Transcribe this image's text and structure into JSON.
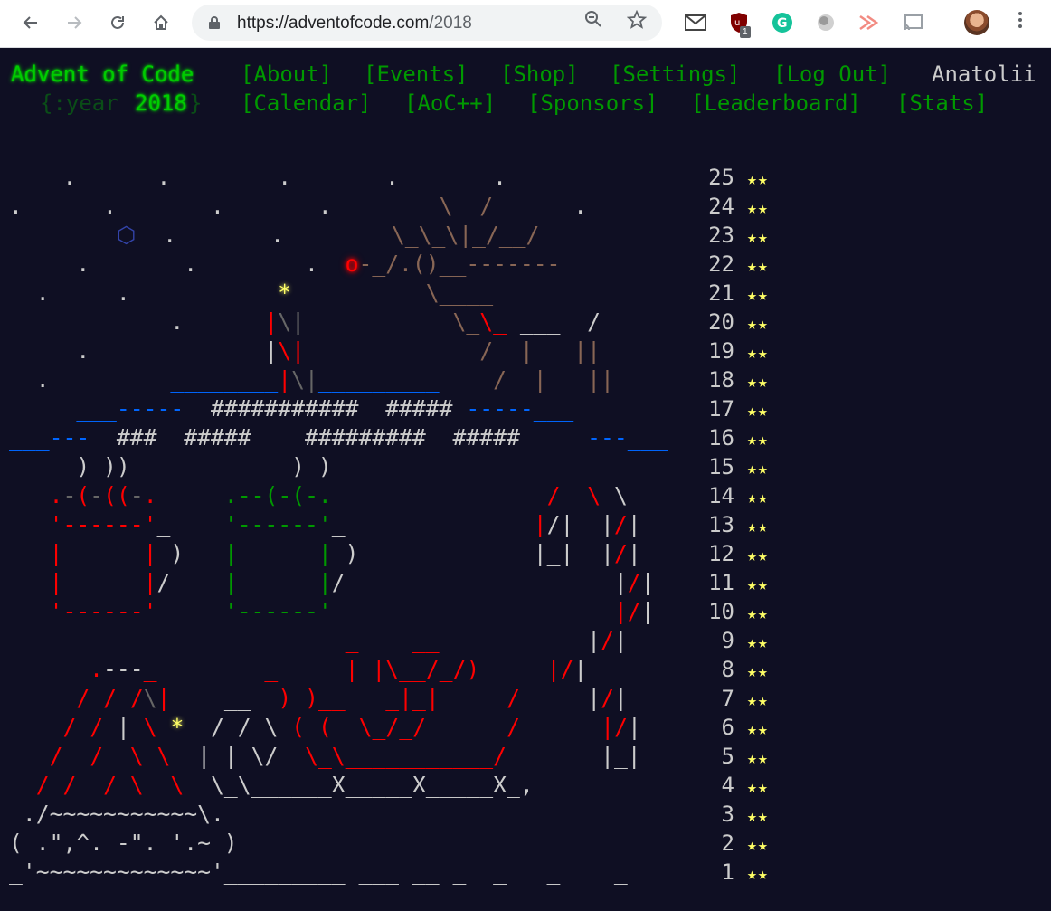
{
  "browser": {
    "url_host": "https://adventofcode.com",
    "url_path": "/2018",
    "ublock_badge": "1"
  },
  "header": {
    "site_title": "Advent of Code",
    "year_prefix": "{:year ",
    "year_value": "2018",
    "year_suffix": "}",
    "nav_row1": [
      "[About]",
      "[Events]",
      "[Shop]",
      "[Settings]",
      "[Log Out]"
    ],
    "nav_row2": [
      "[Calendar]",
      "[AoC++]",
      "[Sponsors]",
      "[Leaderboard]",
      "[Stats]"
    ],
    "user": "Anatolii"
  },
  "calendar": {
    "days": [
      {
        "day": "25",
        "stars": "**"
      },
      {
        "day": "24",
        "stars": "**"
      },
      {
        "day": "23",
        "stars": "**"
      },
      {
        "day": "22",
        "stars": "**"
      },
      {
        "day": "21",
        "stars": "**"
      },
      {
        "day": "20",
        "stars": "**"
      },
      {
        "day": "19",
        "stars": "**"
      },
      {
        "day": "18",
        "stars": "**"
      },
      {
        "day": "17",
        "stars": "**"
      },
      {
        "day": "16",
        "stars": "**"
      },
      {
        "day": "15",
        "stars": "**"
      },
      {
        "day": "14",
        "stars": "**"
      },
      {
        "day": "13",
        "stars": "**"
      },
      {
        "day": "12",
        "stars": "**"
      },
      {
        "day": "11",
        "stars": "**"
      },
      {
        "day": "10",
        "stars": "**"
      },
      {
        "day": "9",
        "stars": "**"
      },
      {
        "day": "8",
        "stars": "**"
      },
      {
        "day": "7",
        "stars": "**"
      },
      {
        "day": "6",
        "stars": "**"
      },
      {
        "day": "5",
        "stars": "**"
      },
      {
        "day": "4",
        "stars": "**"
      },
      {
        "day": "3",
        "stars": "**"
      },
      {
        "day": "2",
        "stars": "**"
      },
      {
        "day": "1",
        "stars": "**"
      }
    ]
  },
  "colors": {
    "background": "#0f0f23",
    "title_green": "#00cc00",
    "link_green": "#009900",
    "star_yellow": "#ffff66",
    "art_gray": "#666666",
    "art_light": "#cccccc",
    "art_red": "#ff0000",
    "art_blue": "#0066ff"
  },
  "icons": {
    "back": "arrow-left",
    "forward": "arrow-right",
    "reload": "reload",
    "home": "home",
    "lock": "lock",
    "zoom": "zoom-out",
    "bookmark": "star",
    "menu": "vertical-dots"
  }
}
